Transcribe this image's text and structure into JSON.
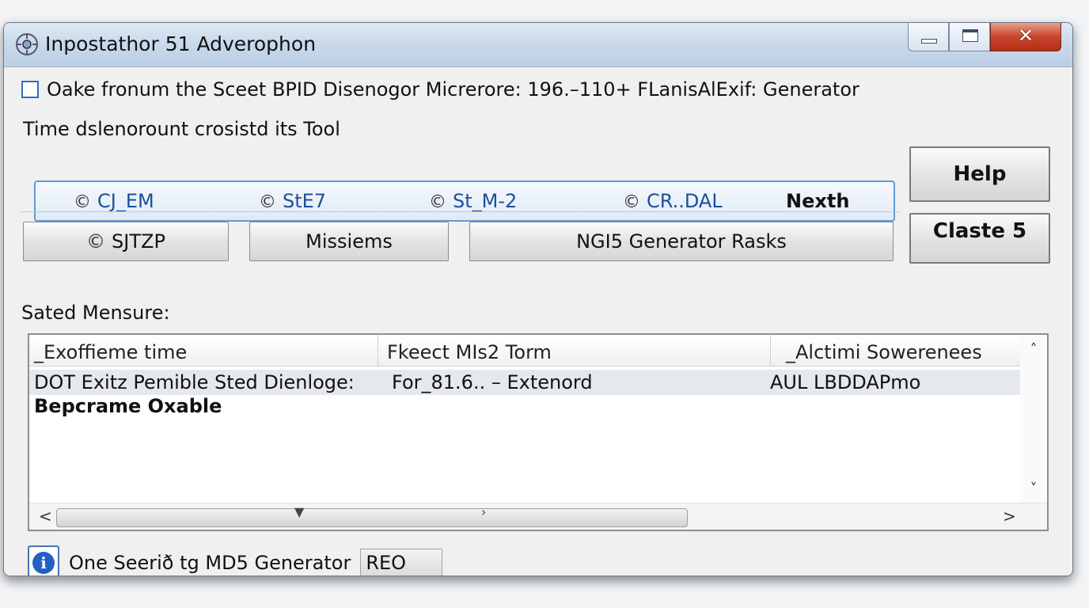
{
  "window": {
    "title": "Inpostathor 51 Adverophon",
    "controls": {
      "minimize_icon": "minimize-icon",
      "maximize_icon": "maximize-icon",
      "close_glyph": "✕"
    }
  },
  "checkbox": {
    "label": "Oake fronum the Sceet BPID Disenogor Micrerore: 196.–110+ FLanisAlExif: Generator",
    "checked": false
  },
  "subtitle": "Time dslenorount crosistd its Tool",
  "radio_group": {
    "options": [
      {
        "label": "CJ_EM"
      },
      {
        "label": "StE7"
      },
      {
        "label": "St_M-2"
      },
      {
        "label": "CR..DAL"
      }
    ],
    "next_label": "Nexth",
    "radio_glyph": "©"
  },
  "buttons": {
    "help": "Help",
    "claste": "Claste 5",
    "sjtzp": "SJTZP",
    "missiems": "Missiems",
    "ngi5": "NGI5 Generator Rasks"
  },
  "section_label": "Sated Mensure:",
  "list": {
    "columns": [
      "_Exoffieme time",
      "Fkeect MIs2 Torm",
      "_Alctimi Sowerenees"
    ],
    "rows": [
      [
        "DOT Exitz Pemible Sted Dienloge:",
        "For_81.6.. – Extenord",
        "AUL LBDDAPmo"
      ],
      [
        "Bepcrame Oxable",
        "",
        ""
      ]
    ],
    "scroll": {
      "up": "˄",
      "down": "˅",
      "left": "<",
      "right": ">"
    }
  },
  "status": {
    "info_icon": "i",
    "text": "One Seerið tg MD5 Generator",
    "value": "REO"
  },
  "colors": {
    "accent": "#2e6fbf",
    "radio_text": "#1d4f9a",
    "close": "#c9452d",
    "info": "#2360c4"
  }
}
